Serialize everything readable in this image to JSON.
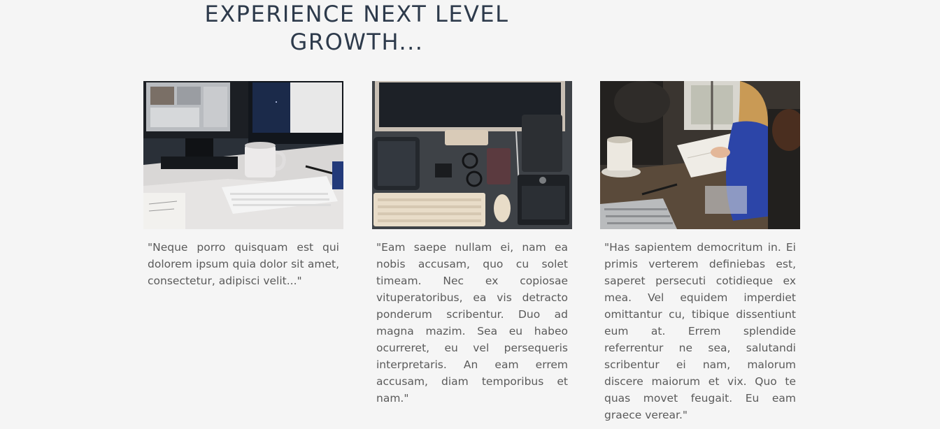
{
  "section": {
    "heading": "EXPERIENCE NEXT LEVEL GROWTH..."
  },
  "cards": [
    {
      "image_desc": "desk-monitors-keyboard-mug-photo",
      "text": "\"Neque porro quisquam est qui dolorem ipsum quia dolor sit amet, consectetur, adipisci velit...\""
    },
    {
      "image_desc": "flatlay-monitor-tablet-keyboard-photo",
      "text": "\"Eam saepe nullam ei, nam ea nobis accusam, quo cu solet timeam. Nec ex copiosae vituperatoribus, ea vis detracto ponderum scribentur. Duo ad magna mazim. Sea eu habeo ocurreret, eu vel persequeris interpretaris. An eam errem accusam, diam temporibus et nam.\""
    },
    {
      "image_desc": "team-meeting-notebook-laptop-photo",
      "text": "\"Has sapientem democritum in. Ei primis verterem definiebas est, saperet persecuti cotidieque ex mea. Vel equidem imperdiet omittantur cu, tibique dissentiunt eum at. Errem splendide referrentur ne sea, salutandi scribentur ei nam, malorum discere maiorum et vix. Quo te quas movet feugait. Eu eam graece verear.\""
    }
  ]
}
